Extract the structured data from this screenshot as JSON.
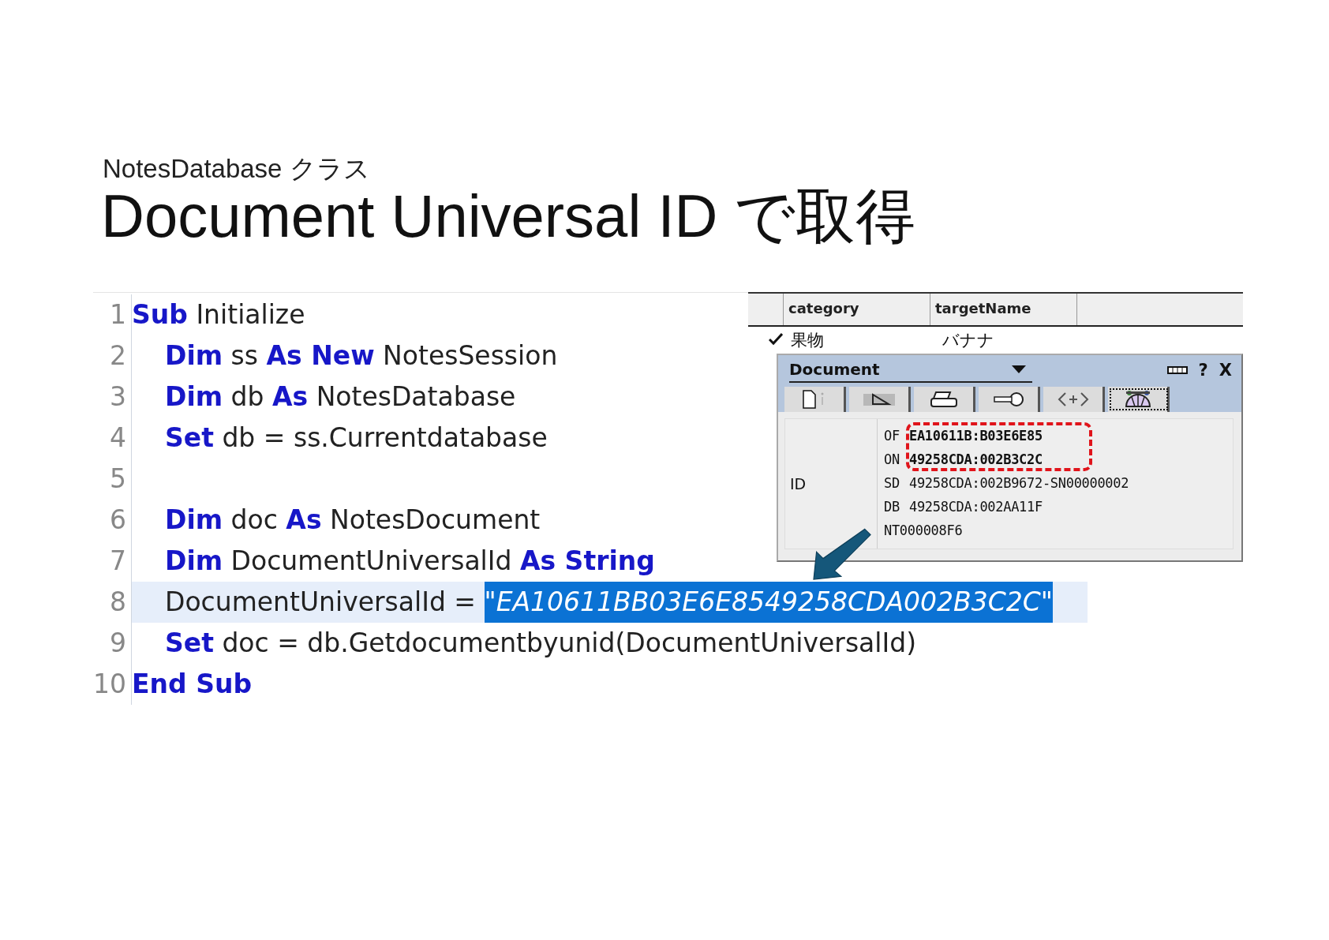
{
  "slide": {
    "subtitle": "NotesDatabase クラス",
    "title": "Document Universal ID で取得"
  },
  "code": {
    "lines": [
      {
        "number": "1",
        "indented": false,
        "current": false,
        "tokens": [
          {
            "text": "Sub",
            "kind": "keyword"
          },
          {
            "text": " Initialize",
            "kind": "plain"
          }
        ]
      },
      {
        "number": "2",
        "indented": true,
        "current": false,
        "tokens": [
          {
            "text": "Dim",
            "kind": "keyword"
          },
          {
            "text": " ss ",
            "kind": "plain"
          },
          {
            "text": "As New",
            "kind": "keyword"
          },
          {
            "text": " NotesSession",
            "kind": "plain"
          }
        ]
      },
      {
        "number": "3",
        "indented": true,
        "current": false,
        "tokens": [
          {
            "text": "Dim",
            "kind": "keyword"
          },
          {
            "text": " db ",
            "kind": "plain"
          },
          {
            "text": "As",
            "kind": "keyword"
          },
          {
            "text": " NotesDatabase",
            "kind": "plain"
          }
        ]
      },
      {
        "number": "4",
        "indented": true,
        "current": false,
        "tokens": [
          {
            "text": "Set",
            "kind": "keyword"
          },
          {
            "text": " db = ss.Currentdatabase",
            "kind": "plain"
          }
        ]
      },
      {
        "number": "5",
        "current": false
      },
      {
        "number": "6",
        "indented": true,
        "current": false,
        "tokens": [
          {
            "text": "Dim",
            "kind": "keyword"
          },
          {
            "text": " doc ",
            "kind": "plain"
          },
          {
            "text": "As",
            "kind": "keyword"
          },
          {
            "text": " NotesDocument",
            "kind": "plain"
          }
        ]
      },
      {
        "number": "7",
        "indented": true,
        "current": false,
        "tokens": [
          {
            "text": "Dim",
            "kind": "keyword"
          },
          {
            "text": " DocumentUniversalId ",
            "kind": "plain"
          },
          {
            "text": "As String",
            "kind": "keyword"
          }
        ]
      },
      {
        "number": "8",
        "indented": true,
        "current": true,
        "tokens": [
          {
            "text": "DocumentUniversalId = ",
            "kind": "plain"
          },
          {
            "text": "\"EA10611BB03E6E8549258CDA002B3C2C\"",
            "kind": "selected-string"
          }
        ]
      },
      {
        "number": "9",
        "indented": true,
        "current": false,
        "tokens": [
          {
            "text": "Set",
            "kind": "keyword"
          },
          {
            "text": " doc = db.Getdocumentbyunid(DocumentUniversalId)",
            "kind": "plain"
          }
        ]
      },
      {
        "number": "10",
        "indented": false,
        "current": false,
        "tokens": [
          {
            "text": "End Sub",
            "kind": "keyword"
          }
        ]
      }
    ]
  },
  "view": {
    "columns": [
      "category",
      "targetName"
    ],
    "rows": [
      {
        "checked": true,
        "cells": [
          "果物",
          "バナナ"
        ]
      }
    ]
  },
  "properties": {
    "title": "Document",
    "help_label": "?",
    "close_label": "X",
    "tabs": [
      {
        "selected": false
      },
      {
        "selected": false
      },
      {
        "selected": false
      },
      {
        "selected": false
      },
      {
        "selected": false
      },
      {
        "selected": true
      }
    ],
    "field_label": "ID",
    "id_lines": [
      {
        "prefix": "OF",
        "value": "EA10611B:B03E6E85",
        "highlighted": true
      },
      {
        "prefix": "ON",
        "value": "49258CDA:002B3C2C",
        "highlighted": true
      },
      {
        "prefix": "SD",
        "value": "49258CDA:002B9672-SN00000002",
        "highlighted": false
      },
      {
        "prefix": "DB",
        "value": "49258CDA:002AA11F",
        "highlighted": false
      },
      {
        "value": "NT000008F6",
        "highlighted": false
      }
    ]
  }
}
